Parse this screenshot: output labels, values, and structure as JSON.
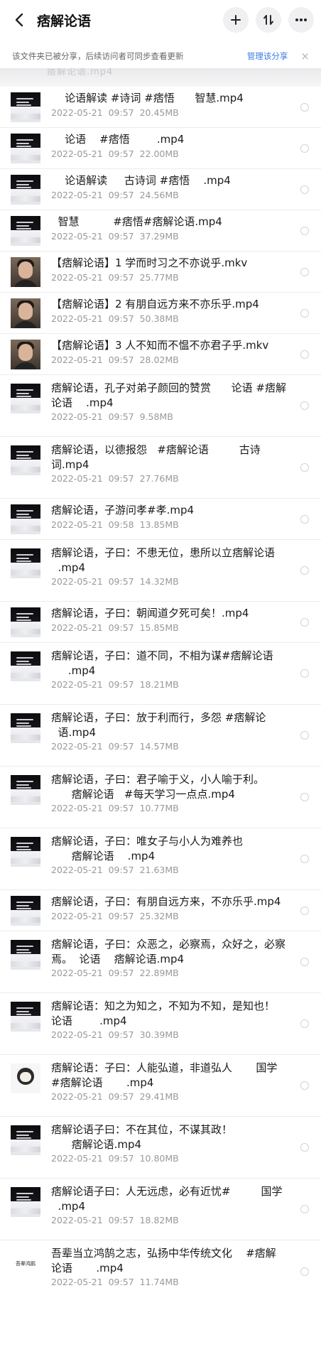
{
  "header": {
    "title": "痞解论语",
    "icons": [
      "back-icon",
      "add-icon",
      "sort-icon",
      "more-icon"
    ]
  },
  "notice": {
    "text": "该文件夹已被分享，后续访问者可同步查看更新",
    "link": "管理该分享",
    "close": "×"
  },
  "ghost_text": "痞解论语.mp4",
  "files": [
    {
      "name": "    论语解读 #诗词 #痞悟      智慧.mp4",
      "date": "2022-05-21",
      "time": "09:57",
      "size": "20.45MB",
      "thumb": "video"
    },
    {
      "name": "    论语    #痞悟        .mp4",
      "date": "2022-05-21",
      "time": "09:57",
      "size": "22.00MB",
      "thumb": "video"
    },
    {
      "name": "    论语解读     古诗词 #痞悟    .mp4",
      "date": "2022-05-21",
      "time": "09:57",
      "size": "24.56MB",
      "thumb": "video"
    },
    {
      "name": "  智慧          #痞悟#痞解论语.mp4",
      "date": "2022-05-21",
      "time": "09:57",
      "size": "37.29MB",
      "thumb": "video"
    },
    {
      "name": "【痞解论语】1 学而时习之不亦说乎.mkv",
      "date": "2022-05-21",
      "time": "09:57",
      "size": "25.77MB",
      "thumb": "person"
    },
    {
      "name": "【痞解论语】2 有朋自远方来不亦乐乎.mp4",
      "date": "2022-05-21",
      "time": "09:57",
      "size": "50.38MB",
      "thumb": "person"
    },
    {
      "name": "【痞解论语】3 人不知而不愠不亦君子乎.mkv",
      "date": "2022-05-21",
      "time": "09:57",
      "size": "28.02MB",
      "thumb": "person"
    },
    {
      "name": "痞解论语，孔子对弟子颜回的赞赏      论语 #痞解论语    .mp4",
      "date": "2022-05-21",
      "time": "09:57",
      "size": "9.58MB",
      "thumb": "video"
    },
    {
      "name": "痞解论语，以德报怨   #痞解论语         古诗词.mp4",
      "date": "2022-05-21",
      "time": "09:57",
      "size": "27.76MB",
      "thumb": "video"
    },
    {
      "name": "痞解论语，子游问孝#孝.mp4",
      "date": "2022-05-21",
      "time": "09:58",
      "size": "13.85MB",
      "thumb": "video"
    },
    {
      "name": "痞解论语，子曰：不患无位，患所以立痞解论语\n  .mp4",
      "date": "2022-05-21",
      "time": "09:57",
      "size": "14.32MB",
      "thumb": "video"
    },
    {
      "name": "痞解论语，子曰：朝闻道夕死可矣！.mp4",
      "date": "2022-05-21",
      "time": "09:57",
      "size": "15.85MB",
      "thumb": "video"
    },
    {
      "name": "痞解论语，子曰：道不同，不相为谋#痞解论语\n     .mp4",
      "date": "2022-05-21",
      "time": "09:57",
      "size": "18.21MB",
      "thumb": "video"
    },
    {
      "name": "痞解论语，子曰：放于利而行，多怨 #痞解论\n  语.mp4",
      "date": "2022-05-21",
      "time": "09:57",
      "size": "14.57MB",
      "thumb": "video"
    },
    {
      "name": "痞解论语，子曰：君子喻于义，小人喻于利。\n      痞解论语   #每天学习一点点.mp4",
      "date": "2022-05-21",
      "time": "09:57",
      "size": "10.77MB",
      "thumb": "video"
    },
    {
      "name": "痞解论语，子曰：唯女子与小人为难养也\n      痞解论语    .mp4",
      "date": "2022-05-21",
      "time": "09:57",
      "size": "21.63MB",
      "thumb": "video"
    },
    {
      "name": "痞解论语，子曰：有朋自远方来，不亦乐乎.mp4",
      "date": "2022-05-21",
      "time": "09:57",
      "size": "25.32MB",
      "thumb": "video"
    },
    {
      "name": "痞解论语，子曰：众恶之，必察焉，众好之，必察焉。  论语    痞解论语.mp4",
      "date": "2022-05-21",
      "time": "09:57",
      "size": "22.89MB",
      "thumb": "video"
    },
    {
      "name": "痞解论语：知之为知之，不知为不知，是知也！\n论语        .mp4",
      "date": "2022-05-21",
      "time": "09:57",
      "size": "30.39MB",
      "thumb": "video"
    },
    {
      "name": "痞解论语：子曰：人能弘道，非道弘人       国学\n#痞解论语       .mp4",
      "date": "2022-05-21",
      "time": "09:57",
      "size": "29.41MB",
      "thumb": "cartoon"
    },
    {
      "name": "痞解论语子曰：不在其位，不谋其政！\n      痞解论语.mp4",
      "date": "2022-05-21",
      "time": "09:57",
      "size": "10.80MB",
      "thumb": "video"
    },
    {
      "name": "痞解论语子曰：人无远虑，必有近忧#         国学\n  .mp4",
      "date": "2022-05-21",
      "time": "09:57",
      "size": "18.82MB",
      "thumb": "video"
    },
    {
      "name": "吾辈当立鸿鹄之志，弘扬中华传统文化    #痞解\n论语       .mp4",
      "date": "2022-05-21",
      "time": "09:57",
      "size": "11.74MB",
      "thumb": "text"
    }
  ],
  "thumb_caption": "吾辈鸿鹄"
}
